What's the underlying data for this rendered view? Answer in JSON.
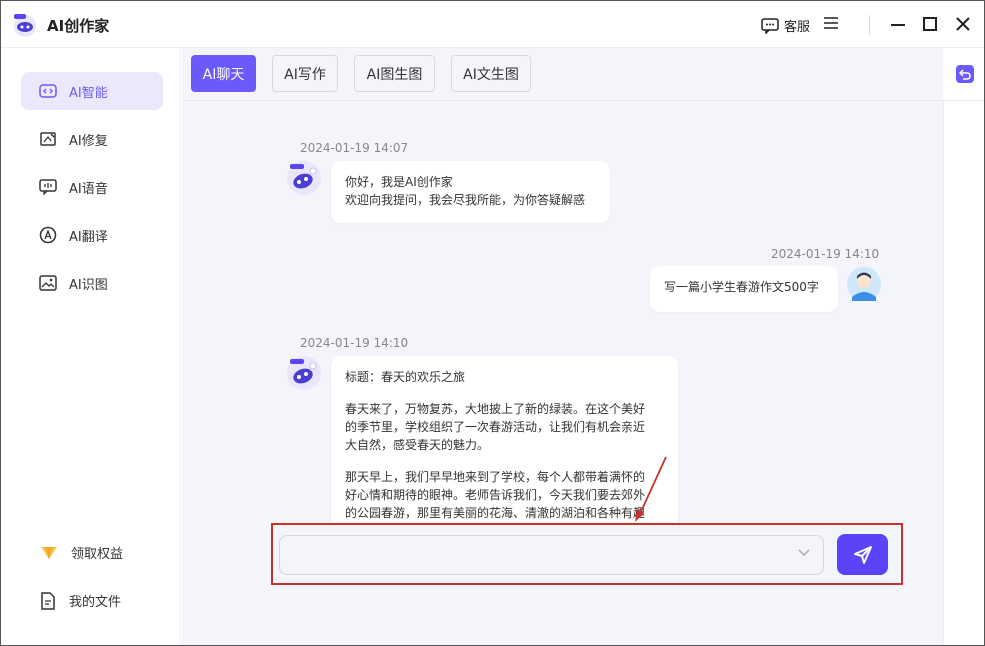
{
  "app": {
    "title": "AI创作家"
  },
  "titlebar": {
    "kefu_label": "客服"
  },
  "sidebar": {
    "items": [
      {
        "label": "AI智能",
        "icon": "ai-chip-icon",
        "active": true
      },
      {
        "label": "AI修复",
        "icon": "image-repair-icon",
        "active": false
      },
      {
        "label": "AI语音",
        "icon": "voice-message-icon",
        "active": false
      },
      {
        "label": "AI翻译",
        "icon": "translate-icon",
        "active": false
      },
      {
        "label": "AI识图",
        "icon": "image-recognize-icon",
        "active": false
      }
    ],
    "bottom": [
      {
        "label": "领取权益",
        "icon": "diamond-icon"
      },
      {
        "label": "我的文件",
        "icon": "file-icon"
      }
    ]
  },
  "tabs": [
    {
      "label": "AI聊天",
      "active": true
    },
    {
      "label": "AI写作",
      "active": false
    },
    {
      "label": "AI图生图",
      "active": false
    },
    {
      "label": "AI文生图",
      "active": false
    }
  ],
  "messages": [
    {
      "role": "assistant",
      "time": "2024-01-19 14:07",
      "lines": [
        "你好，我是AI创作家",
        "欢迎向我提问，我会尽我所能，为你答疑解惑"
      ]
    },
    {
      "role": "user",
      "time": "2024-01-19 14:10",
      "text": "写一篇小学生春游作文500字"
    },
    {
      "role": "assistant",
      "time": "2024-01-19 14:10",
      "title": "标题：春天的欢乐之旅",
      "para1": [
        "春天来了，万物复苏，大地披上了新的绿装。在这个美好",
        "的季节里，学校组织了一次春游活动，让我们有机会亲近",
        "大自然，感受春天的魅力。"
      ],
      "para2": [
        "那天早上，我们早早地来到了学校，每个人都带着满怀的",
        "好心情和期待的眼神。老师告诉我们，今天我们要去郊外",
        "的公园春游，那里有美丽的花海、清澈的湖泊和各种有趣"
      ]
    }
  ],
  "input": {
    "value": "",
    "placeholder": ""
  },
  "colors": {
    "accent": "#6a5af9",
    "send": "#5b44f8",
    "highlight": "#c8302e"
  }
}
